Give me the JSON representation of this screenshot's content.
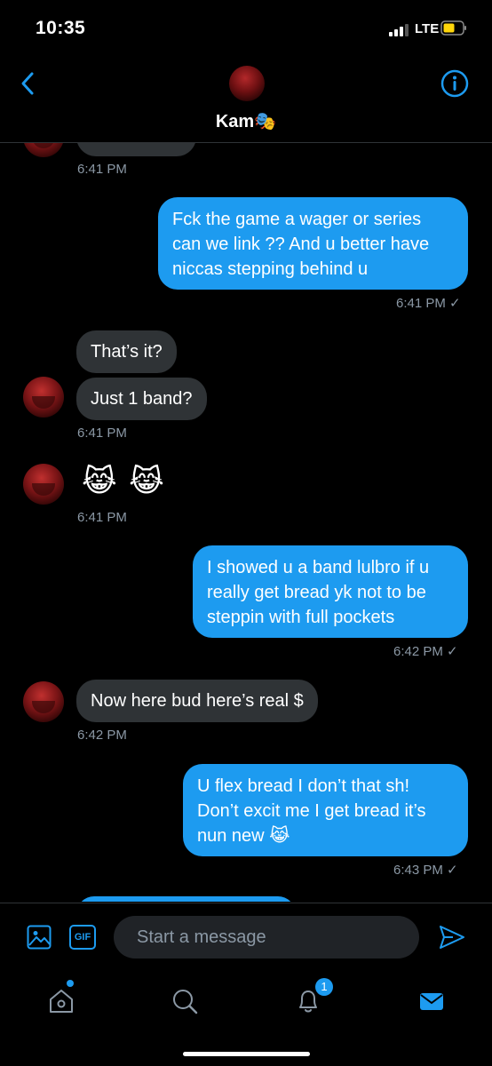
{
  "status": {
    "time": "10:35",
    "network": "LTE"
  },
  "header": {
    "name": "Kam🎭"
  },
  "messages": [
    {
      "ts": "6:41 PM"
    },
    {
      "text": "Fck the game a wager or series can we link ?? And u better have niccas stepping behind u",
      "ts": "6:41 PM ✓"
    },
    {
      "text": "That’s it?"
    },
    {
      "text": "Just 1 band?",
      "ts": "6:41 PM"
    },
    {
      "text": "😹 😹",
      "ts": "6:41 PM"
    },
    {
      "text": "I showed u a band lulbro if u really get bread yk not to be steppin with full pockets",
      "ts": "6:42 PM ✓"
    },
    {
      "text": "Now here bud here’s real $",
      "ts": "6:42 PM"
    },
    {
      "text": "U flex bread I don’t that sh! Don’t excit me I get bread it’s nun new 😹",
      "ts": "6:43 PM ✓"
    }
  ],
  "composer": {
    "placeholder": "Start a message",
    "gif_label": "GIF"
  },
  "tabbar": {
    "notifications_count": "1"
  },
  "colors": {
    "accent": "#1d9bf0",
    "incoming": "#2f3336",
    "background": "#000000"
  }
}
